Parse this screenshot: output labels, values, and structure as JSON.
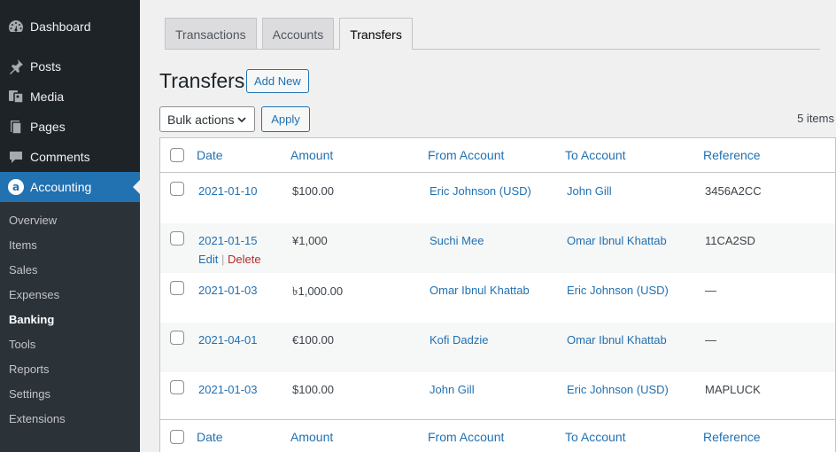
{
  "sidebar": {
    "menu": [
      {
        "label": "Dashboard",
        "icon": "dashboard-icon"
      },
      {
        "label": "Posts",
        "icon": "pin-icon"
      },
      {
        "label": "Media",
        "icon": "media-icon"
      },
      {
        "label": "Pages",
        "icon": "pages-icon"
      },
      {
        "label": "Comments",
        "icon": "comments-icon"
      },
      {
        "label": "Accounting",
        "icon": "accounting-icon"
      }
    ],
    "submenu": [
      "Overview",
      "Items",
      "Sales",
      "Expenses",
      "Banking",
      "Tools",
      "Reports",
      "Settings",
      "Extensions"
    ],
    "current_submenu": "Banking"
  },
  "tabs": [
    "Transactions",
    "Accounts",
    "Transfers"
  ],
  "active_tab": "Transfers",
  "page": {
    "title": "Transfers",
    "add_new": "Add New",
    "bulk_actions": "Bulk actions",
    "apply": "Apply",
    "count": "5 items"
  },
  "table": {
    "columns": [
      "Date",
      "Amount",
      "From Account",
      "To Account",
      "Reference"
    ],
    "row_actions": {
      "edit": "Edit",
      "sep": "|",
      "delete": "Delete"
    },
    "rows": [
      {
        "date": "2021-01-10",
        "amount": "$100.00",
        "from": "Eric Johnson (USD)",
        "to": "John Gill",
        "reference": "3456A2CC"
      },
      {
        "date": "2021-01-15",
        "amount": "¥1,000",
        "from": "Suchi Mee",
        "to": "Omar Ibnul Khattab",
        "reference": "11CA2SD"
      },
      {
        "date": "2021-01-03",
        "amount": "৳1,000.00",
        "from": "Omar Ibnul Khattab",
        "to": "Eric Johnson (USD)",
        "reference": "—"
      },
      {
        "date": "2021-04-01",
        "amount": "€100.00",
        "from": "Kofi Dadzie",
        "to": "Omar Ibnul Khattab",
        "reference": "—"
      },
      {
        "date": "2021-01-03",
        "amount": "$100.00",
        "from": "John Gill",
        "to": "Eric Johnson (USD)",
        "reference": "MAPLUCK"
      }
    ]
  },
  "colors": {
    "accent": "#2271b1",
    "sidebar_bg": "#1d2327",
    "submenu_bg": "#2c3338",
    "delete": "#b32d2e"
  }
}
